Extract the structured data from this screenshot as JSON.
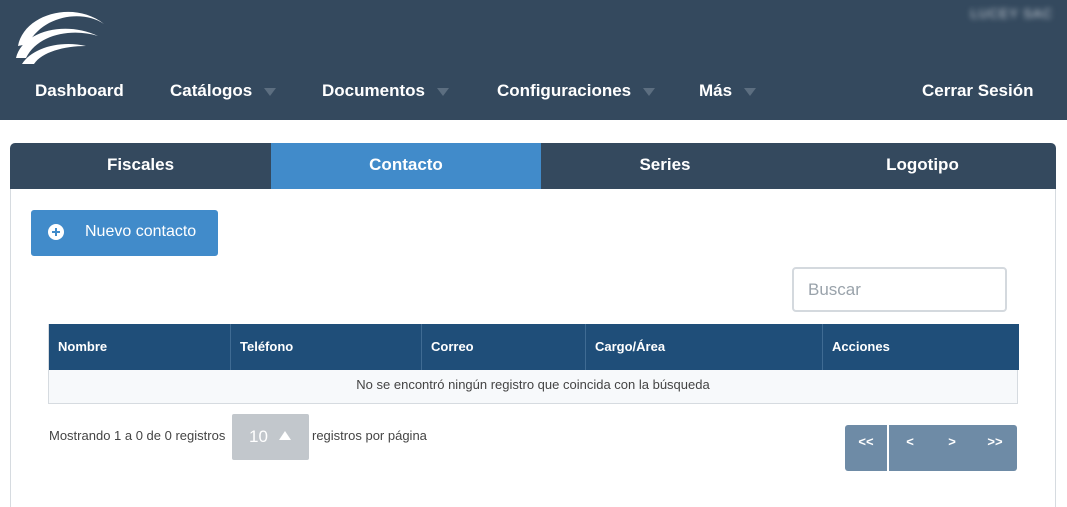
{
  "header": {
    "user_name": "LUCEY SAC",
    "nav": [
      {
        "label": "Dashboard",
        "has_caret": false
      },
      {
        "label": "Catálogos",
        "has_caret": true
      },
      {
        "label": "Documentos",
        "has_caret": true
      },
      {
        "label": "Configuraciones",
        "has_caret": true
      },
      {
        "label": "Más",
        "has_caret": true
      }
    ],
    "logout_label": "Cerrar Sesión"
  },
  "tabs": [
    {
      "label": "Fiscales",
      "active": false
    },
    {
      "label": "Contacto",
      "active": true
    },
    {
      "label": "Series",
      "active": false
    },
    {
      "label": "Logotipo",
      "active": false
    }
  ],
  "new_contact_button": {
    "label": "Nuevo contacto",
    "icon": "plus-circle-icon"
  },
  "search": {
    "placeholder": "Buscar",
    "value": ""
  },
  "table": {
    "columns": [
      "Nombre",
      "Teléfono",
      "Correo",
      "Cargo/Área",
      "Acciones"
    ],
    "rows": [],
    "empty_message": "No se encontró ningún registro que coincida con la búsqueda"
  },
  "footer": {
    "showing_text": "Mostrando 1 a 0 de 0 registros",
    "page_size": "10",
    "per_page_text": "registros por página",
    "pager": [
      "<<",
      "<",
      ">",
      ">>"
    ]
  },
  "colors": {
    "header_bg": "#34495e",
    "accent": "#418bca",
    "table_header_bg": "#1f4e79",
    "pager_bg": "#6e8ba6"
  }
}
